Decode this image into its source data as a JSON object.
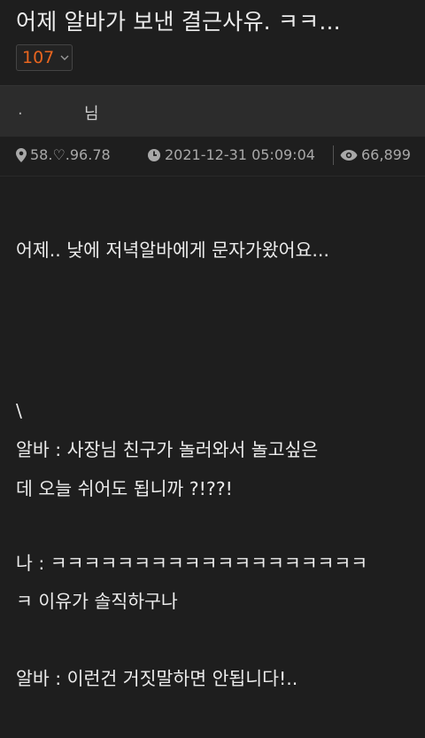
{
  "post": {
    "title": "어제 알바가 보낸 결근사유. ㅋㅋ...",
    "vote_count": "107",
    "author_prefix": ".",
    "author_suffix": "님",
    "ip": "58.♡.96.78",
    "date": "2021-12-31 05:09:04",
    "views": "66,899"
  },
  "content": {
    "line1": "어제.. 낮에 저녁알바에게 문자가왔어요...",
    "line2": "\\",
    "line3": "알바 : 사장님 친구가 놀러와서 놀고싶은",
    "line4": "데 오늘 쉬어도 됩니까 ?!??!",
    "line5": "나 : ㅋㅋㅋㅋㅋㅋㅋㅋㅋㅋㅋㅋㅋㅋㅋㅋㅋㅋㅋ",
    "line6": "ㅋ 이유가 솔직하구나",
    "line7": "알바 : 이런건 거짓말하면 안됩니다!.."
  },
  "colors": {
    "background": "#1e1e1e",
    "author_bar": "#2c2c2c",
    "vote_accent": "#e8651f"
  },
  "icons": [
    "location-pin-icon",
    "clock-icon",
    "eye-icon",
    "chevron-down-icon"
  ]
}
